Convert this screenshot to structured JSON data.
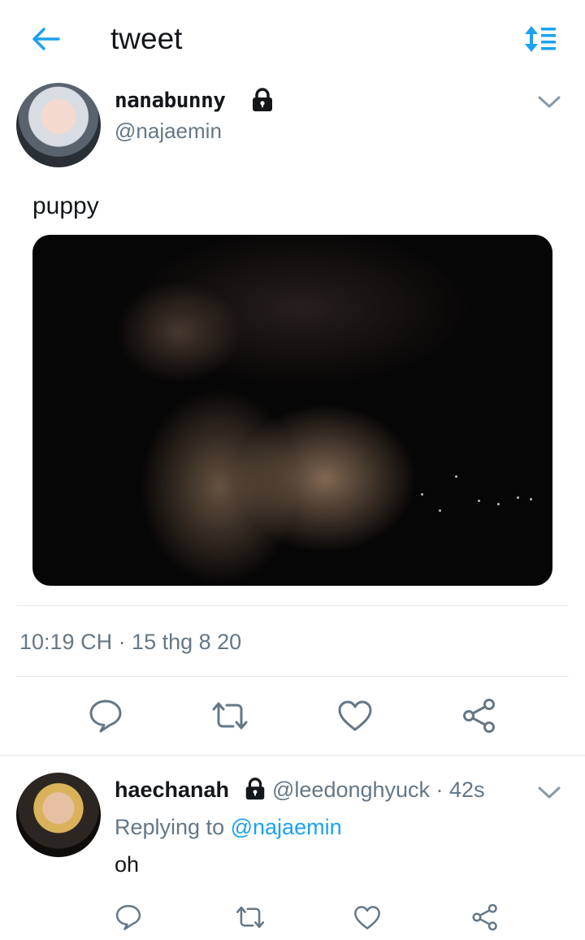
{
  "header": {
    "title": "tweet",
    "back_icon": "arrow-left-icon",
    "sort_icon": "sort-icon",
    "accent_color": "#1da1f2"
  },
  "main_tweet": {
    "display_name": "nanabunny",
    "handle": "@najaemin",
    "lock_icon": "lock-icon",
    "text": "puppy",
    "timestamp": "10:19 CH · 15 thg 8 20",
    "actions": [
      "reply-icon",
      "retweet-icon",
      "like-icon",
      "share-icon"
    ]
  },
  "reply": {
    "display_name": "haechanah",
    "meta": "@leedonghyuck · 42s",
    "replying_prefix": "Replying to",
    "replying_mention": "@najaemin",
    "text": "oh",
    "actions": [
      "reply-icon",
      "retweet-icon",
      "like-icon",
      "share-icon"
    ]
  },
  "colors": {
    "text": "#14171a",
    "secondary": "#657786",
    "divider": "#e1e8ed",
    "link": "#1da1f2"
  }
}
